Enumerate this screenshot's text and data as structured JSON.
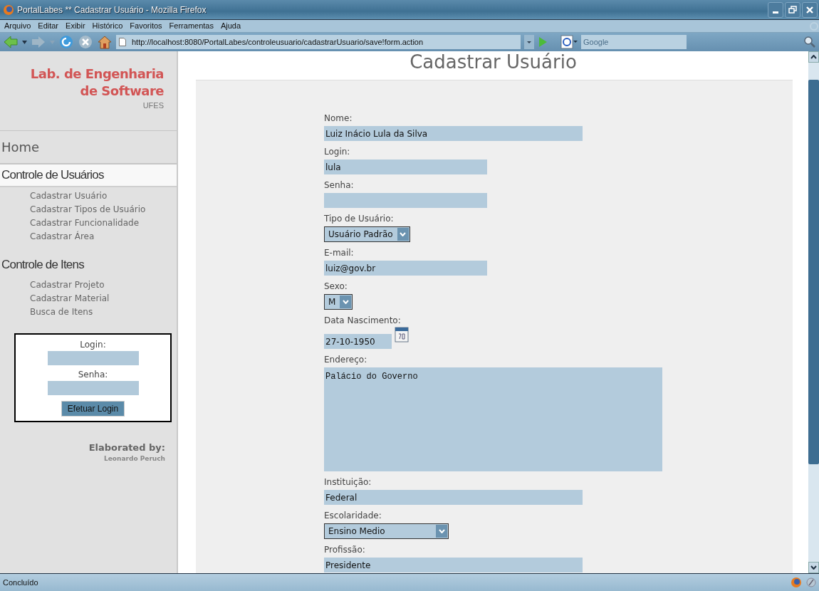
{
  "window": {
    "title": "PortalLabes ** Cadastrar Usuário - Mozilla Firefox"
  },
  "menu": [
    "Arquivo",
    "Editar",
    "Exibir",
    "Histórico",
    "Favoritos",
    "Ferramentas",
    "Ajuda"
  ],
  "toolbar": {
    "url": "http://localhost:8080/PortalLabes/controleusuario/cadastrarUsuario/save!form.action",
    "search_placeholder": "Google"
  },
  "sidebar": {
    "logo_lines": [
      "Lab. de Engenharia",
      "de Software"
    ],
    "subtitle": "UFES",
    "home": "Home",
    "sections": [
      {
        "title": "Controle de Usuários",
        "selected": true,
        "items": [
          "Cadastrar Usuário",
          "Cadastrar Tipos de Usuário",
          "Cadastrar Funcionalidade",
          "Cadastrar Área"
        ]
      },
      {
        "title": "Controle de Itens",
        "selected": false,
        "items": [
          "Cadastrar Projeto",
          "Cadastrar Material",
          "Busca de Itens"
        ]
      }
    ],
    "login_box": {
      "login_label": "Login:",
      "password_label": "Senha:",
      "button": "Efetuar Login"
    },
    "credits": {
      "label": "Elaborated by:",
      "author": "Leonardo Peruch"
    }
  },
  "page": {
    "heading": "Cadastrar Usuário",
    "fields": [
      {
        "label": "Nome:",
        "kind": "text",
        "value": "Luiz Inácio Lula da Silva"
      },
      {
        "label": "Login:",
        "kind": "text",
        "value": "lula"
      },
      {
        "label": "Senha:",
        "kind": "password"
      },
      {
        "label": "Tipo de Usuário:",
        "kind": "select",
        "value": "Usuário Padrão"
      },
      {
        "label": "E-mail:",
        "kind": "text",
        "value": "luiz@gov.br"
      },
      {
        "label": "Sexo:",
        "kind": "select",
        "value": "M"
      },
      {
        "label": "Data Nascimento:",
        "kind": "date",
        "value": "27-10-1950"
      },
      {
        "label": "Endereço:",
        "kind": "textarea",
        "value": "Palácio do Governo"
      },
      {
        "label": "Instituição:",
        "kind": "text",
        "value": "Federal"
      },
      {
        "label": "Escolaridade:",
        "kind": "select",
        "value": "Ensino Medio"
      },
      {
        "label": "Profissão:",
        "kind": "text",
        "value": "Presidente"
      }
    ]
  },
  "status_bar": {
    "text": "Concluído"
  }
}
